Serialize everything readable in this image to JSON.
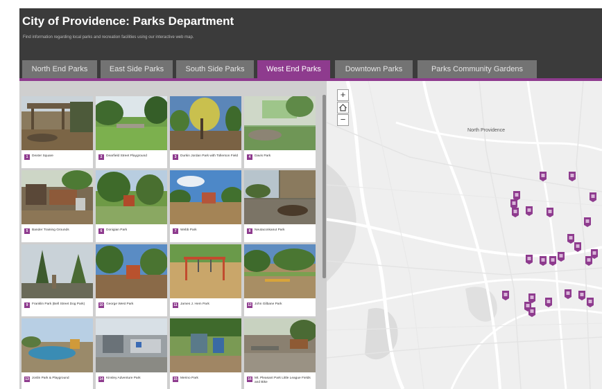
{
  "header": {
    "title": "City of Providence: Parks Department",
    "subtitle": "Find information regarding local parks and recreation facilities using our interactive web map."
  },
  "tabs": [
    {
      "label": "North End Parks",
      "active": false
    },
    {
      "label": "East Side Parks",
      "active": false
    },
    {
      "label": "South Side Parks",
      "active": false
    },
    {
      "label": "West End Parks",
      "active": true
    },
    {
      "label": "Downtown Parks",
      "active": false
    },
    {
      "label": "Parks Community Gardens",
      "active": false
    }
  ],
  "gallery": {
    "cards": [
      {
        "num": "1",
        "title": "Dexter Square"
      },
      {
        "num": "2",
        "title": "Dearfield Street Playground"
      },
      {
        "num": "3",
        "title": "Durkin Jordan Park with Tollerson Field"
      },
      {
        "num": "4",
        "title": "Davis Park"
      },
      {
        "num": "5",
        "title": "Bander Training Grounds"
      },
      {
        "num": "6",
        "title": "Donigian Park"
      },
      {
        "num": "7",
        "title": "Webb Park"
      },
      {
        "num": "8",
        "title": "Neutaconkanut Park"
      },
      {
        "num": "9",
        "title": "Franklin Park (Bell Street Dog Park)"
      },
      {
        "num": "10",
        "title": "George West Park"
      },
      {
        "num": "11",
        "title": "James J. Hem Park"
      },
      {
        "num": "12",
        "title": "John Gilbane Park"
      },
      {
        "num": "13",
        "title": "Joslin Park & Playground"
      },
      {
        "num": "14",
        "title": "Kinsley Adventure Park"
      },
      {
        "num": "15",
        "title": "Merino Park"
      },
      {
        "num": "16",
        "title": "Mt. Pleasant Park Little League Fields and Bike"
      }
    ]
  },
  "map": {
    "place_label": "North Providence",
    "zoom_in_symbol": "+",
    "home_icon": "home-icon",
    "zoom_out_symbol": "−"
  },
  "colors": {
    "accent": "#8e3b8e",
    "header_bg": "#3b3b3b",
    "tab_inactive": "#737373",
    "map_bg": "#efefef",
    "gallery_bg": "#cfcfcf"
  }
}
